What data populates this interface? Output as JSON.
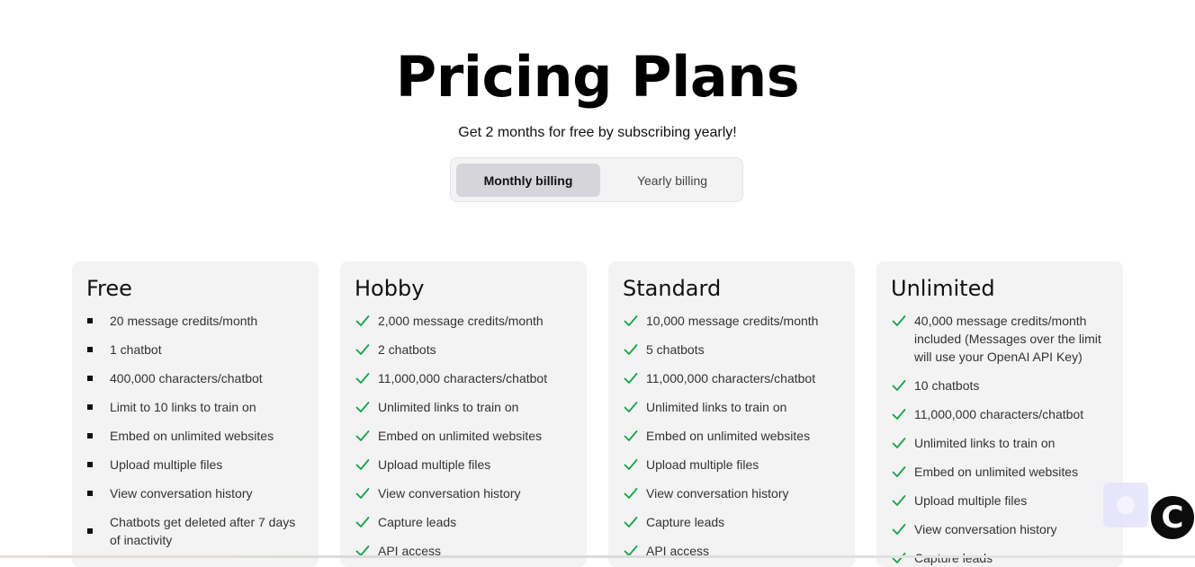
{
  "header": {
    "title": "Pricing Plans",
    "subtitle": "Get 2 months for free by subscribing yearly!"
  },
  "billing_toggle": {
    "monthly_label": "Monthly billing",
    "yearly_label": "Yearly billing",
    "selected": "Monthly billing"
  },
  "plans": [
    {
      "name": "Free",
      "marker": "square-bullet",
      "features": [
        "20 message credits/month",
        "1 chatbot",
        "400,000 characters/chatbot",
        "Limit to 10 links to train on",
        "Embed on unlimited websites",
        "Upload multiple files",
        "View conversation history",
        "Chatbots get deleted after 7 days of inactivity"
      ]
    },
    {
      "name": "Hobby",
      "marker": "check-icon",
      "features": [
        "2,000 message credits/month",
        "2 chatbots",
        "11,000,000 characters/chatbot",
        "Unlimited links to train on",
        "Embed on unlimited websites",
        "Upload multiple files",
        "View conversation history",
        "Capture leads",
        "API access"
      ]
    },
    {
      "name": "Standard",
      "marker": "check-icon",
      "features": [
        "10,000 message credits/month",
        "5 chatbots",
        "11,000,000 characters/chatbot",
        "Unlimited links to train on",
        "Embed on unlimited websites",
        "Upload multiple files",
        "View conversation history",
        "Capture leads",
        "API access"
      ]
    },
    {
      "name": "Unlimited",
      "marker": "check-icon",
      "features": [
        "40,000 message credits/month included (Messages over the limit will use your OpenAI API Key)",
        "10 chatbots",
        "11,000,000 characters/chatbot",
        "Unlimited links to train on",
        "Embed on unlimited websites",
        "Upload multiple files",
        "View conversation history",
        "Capture leads"
      ]
    }
  ],
  "widget": {
    "chat_button_glyph": "C"
  },
  "colors": {
    "check": "#16a34a",
    "card_bg": "#f3f3f3",
    "toggle_selected_bg": "#d6d6da"
  }
}
